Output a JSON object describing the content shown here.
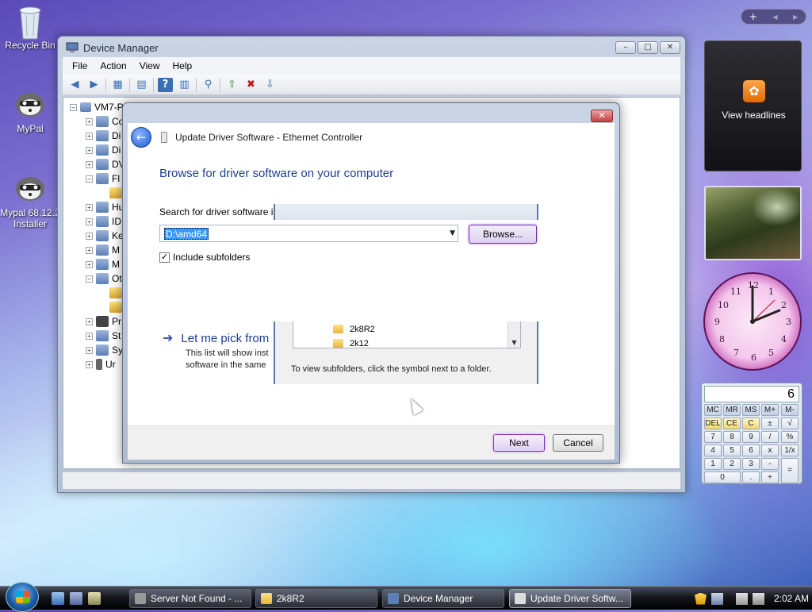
{
  "desktop": {
    "icons": [
      {
        "label": "Recycle Bin"
      },
      {
        "label": "MyPal"
      },
      {
        "label": "Mypal 68.12.2"
      },
      {
        "label": "Installer"
      }
    ]
  },
  "device_manager": {
    "title": "Device Manager",
    "window_buttons": [
      "–",
      "□",
      "✕"
    ],
    "menu": [
      "File",
      "Action",
      "View",
      "Help"
    ],
    "tree": {
      "root": "VM7-P",
      "items": [
        "Co",
        "Di",
        "Di",
        "DV",
        "Fl",
        "",
        "Hu",
        "ID",
        "Ke",
        "M",
        "M",
        "Ot",
        "",
        "",
        "Pr",
        "St",
        "Sy",
        "Ur"
      ]
    }
  },
  "dialog": {
    "title": "Update Driver Software - Ethernet Controller",
    "close_label": "✕",
    "heading": "Browse for driver software on your computer",
    "search_label": "Search for driver software in",
    "path_value": "D:\\amd64",
    "browse_label": "Browse...",
    "include_subfolders": "Include subfolders",
    "pick_title": "Let me pick from",
    "pick_desc_line1": "This list will show inst",
    "pick_desc_line2": "software in the same",
    "next_label": "Next",
    "cancel_label": "Cancel"
  },
  "browse_folder": {
    "folders": [
      "2k8R2",
      "2k12"
    ],
    "hint": "To view subfolders, click the symbol next to a folder."
  },
  "gadgets": {
    "sidebar_controls": [
      "+",
      "◂",
      "▸"
    ],
    "feed_label": "View headlines",
    "clock_numbers": [
      "12",
      "1",
      "2",
      "3",
      "4",
      "5",
      "6",
      "7",
      "8",
      "9",
      "10",
      "11"
    ],
    "calculator": {
      "display": "6",
      "keys": [
        [
          "MC",
          "MR",
          "MS",
          "M+",
          "M-"
        ],
        [
          "DEL",
          "CE",
          "C",
          "±",
          "√"
        ],
        [
          "7",
          "8",
          "9",
          "/",
          "%"
        ],
        [
          "4",
          "5",
          "6",
          "x",
          "1/x"
        ],
        [
          "1",
          "2",
          "3",
          "-",
          "="
        ],
        [
          "0",
          ".",
          "+"
        ]
      ]
    }
  },
  "taskbar": {
    "tasks": [
      {
        "label": "Server Not Found - ..."
      },
      {
        "label": "2k8R2"
      },
      {
        "label": "Device Manager"
      },
      {
        "label": "Update Driver Softw..."
      }
    ],
    "clock": "2:02 AM"
  },
  "colors": {
    "accent": "#1e3d8f",
    "focus_glow": "#c48ef2",
    "selection": "#3399ff"
  }
}
